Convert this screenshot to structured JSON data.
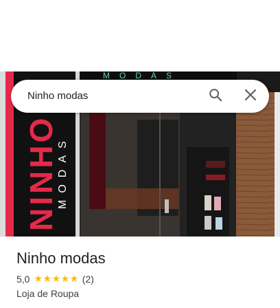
{
  "search": {
    "query": "Ninho modas"
  },
  "photo": {
    "banner_text": "NINHO",
    "banner_subtext": "MODAS",
    "sign_text": "MODAS"
  },
  "place": {
    "name": "Ninho modas",
    "rating": "5,0",
    "rating_stars": 5,
    "review_count": "(2)",
    "category": "Loja de Roupa"
  },
  "colors": {
    "star": "#fbbc04",
    "banner_red": "#e5294a",
    "banner_black": "#111111",
    "wood": "#8a5a3a"
  },
  "icons": {
    "search": "search-icon",
    "close": "close-icon",
    "star": "star-icon"
  }
}
